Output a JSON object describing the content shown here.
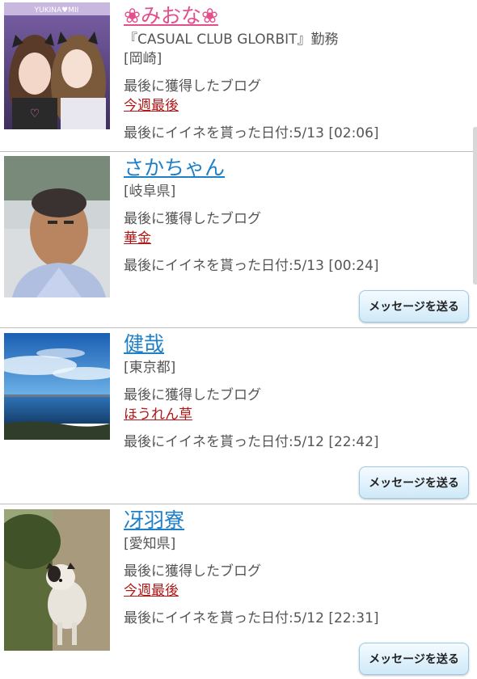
{
  "blog_label": "最後に獲得したブログ",
  "like_prefix": "最後にイイネを貰った日付:",
  "message_button_label": "メッセージを送る",
  "users": [
    {
      "name": "❀みおな❀",
      "shop": "『CASUAL CLUB GLORBIT』勤務",
      "location": "[岡崎]",
      "blog": "今週最後",
      "like_date": "5/13 [02:06]"
    },
    {
      "name": "さかちゃん",
      "location": "[岐阜県]",
      "blog": "華金",
      "like_date": "5/13 [00:24]"
    },
    {
      "name": "健哉",
      "location": "[東京都]",
      "blog": "ほうれん草",
      "like_date": "5/12 [22:42]"
    },
    {
      "name": "冴羽寮",
      "location": "[愛知県]",
      "blog": "今週最後",
      "like_date": "5/12 [22:31]"
    }
  ],
  "photo_texts": {
    "purikura_header": "YUKINA♥MII"
  }
}
